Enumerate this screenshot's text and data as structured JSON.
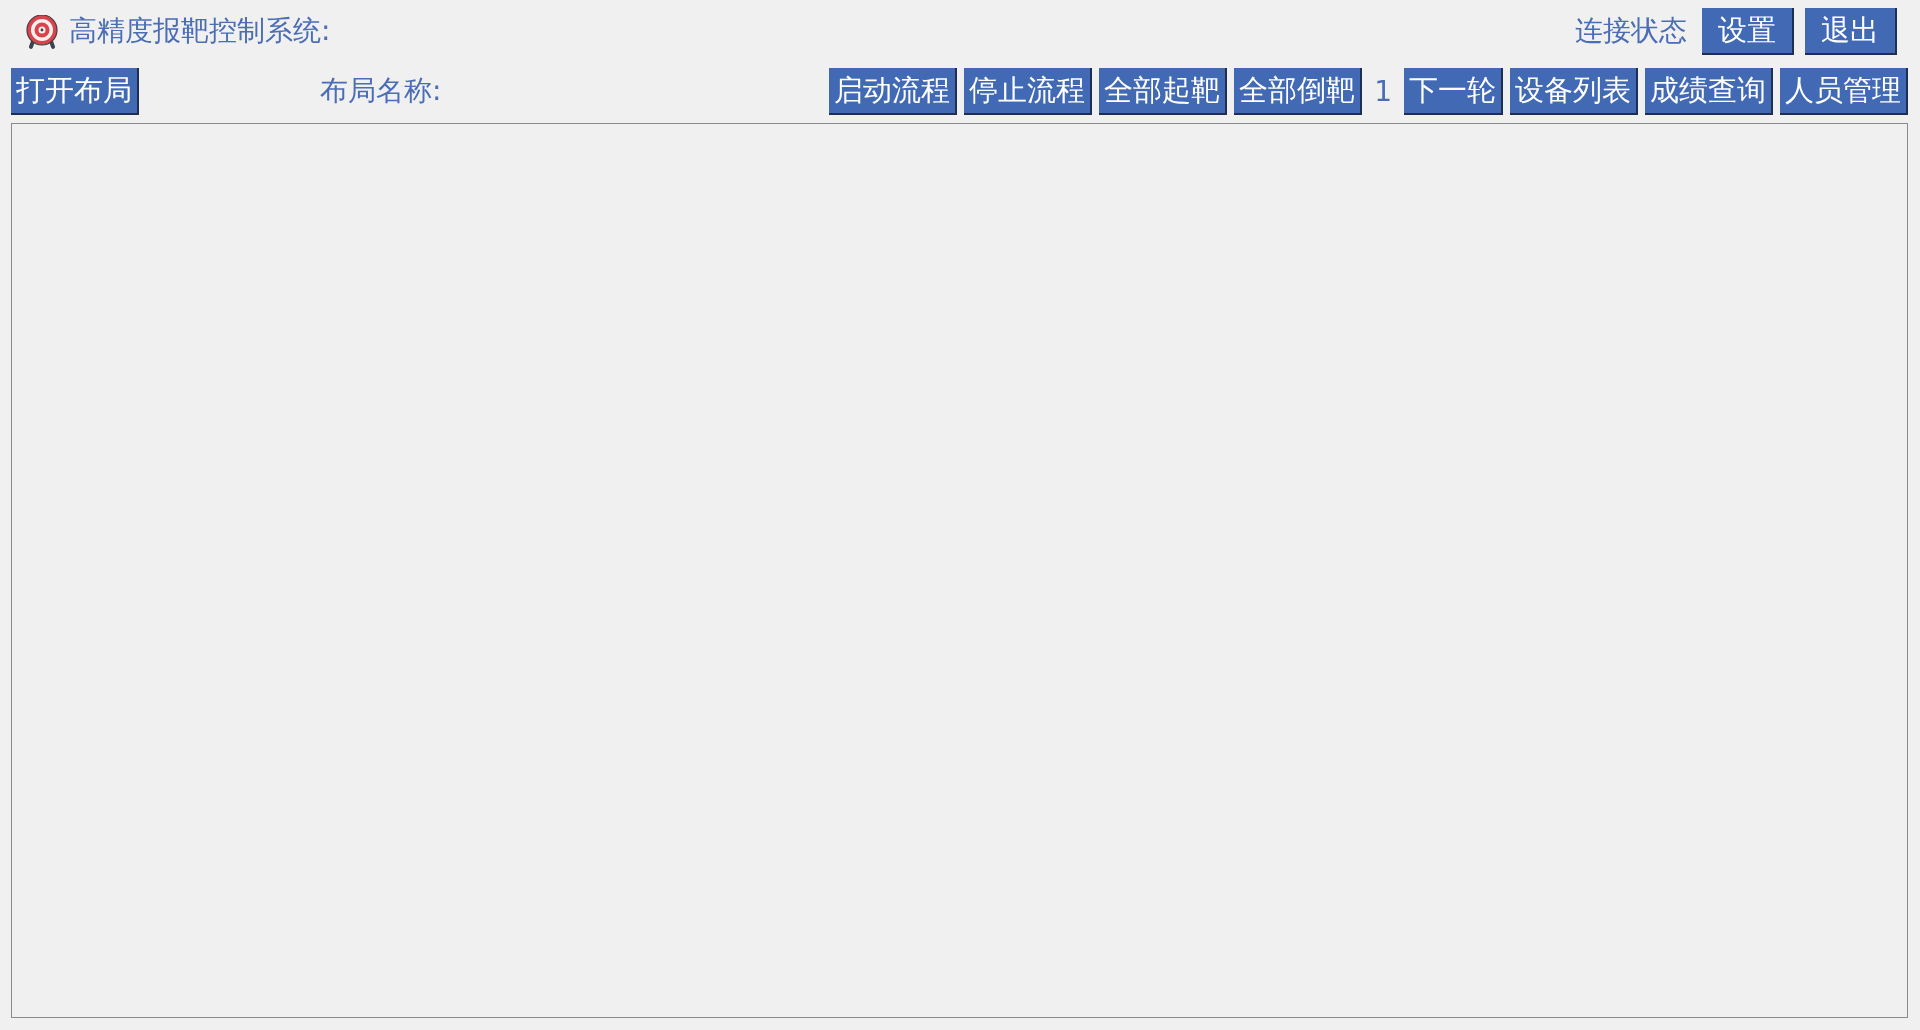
{
  "header": {
    "title": "高精度报靶控制系统:",
    "connection_status": "连接状态",
    "buttons": [
      "设置",
      "退出"
    ]
  },
  "toolbar": {
    "open_button": "打开布局",
    "layout_name_label": "布局名称:",
    "flow_buttons": [
      "启动流程",
      "停止流程",
      "全部起靶",
      "全部倒靶"
    ],
    "round_number": "1",
    "buttons": [
      "下一轮",
      "设备列表",
      "成绩查询",
      "人员管理"
    ]
  }
}
